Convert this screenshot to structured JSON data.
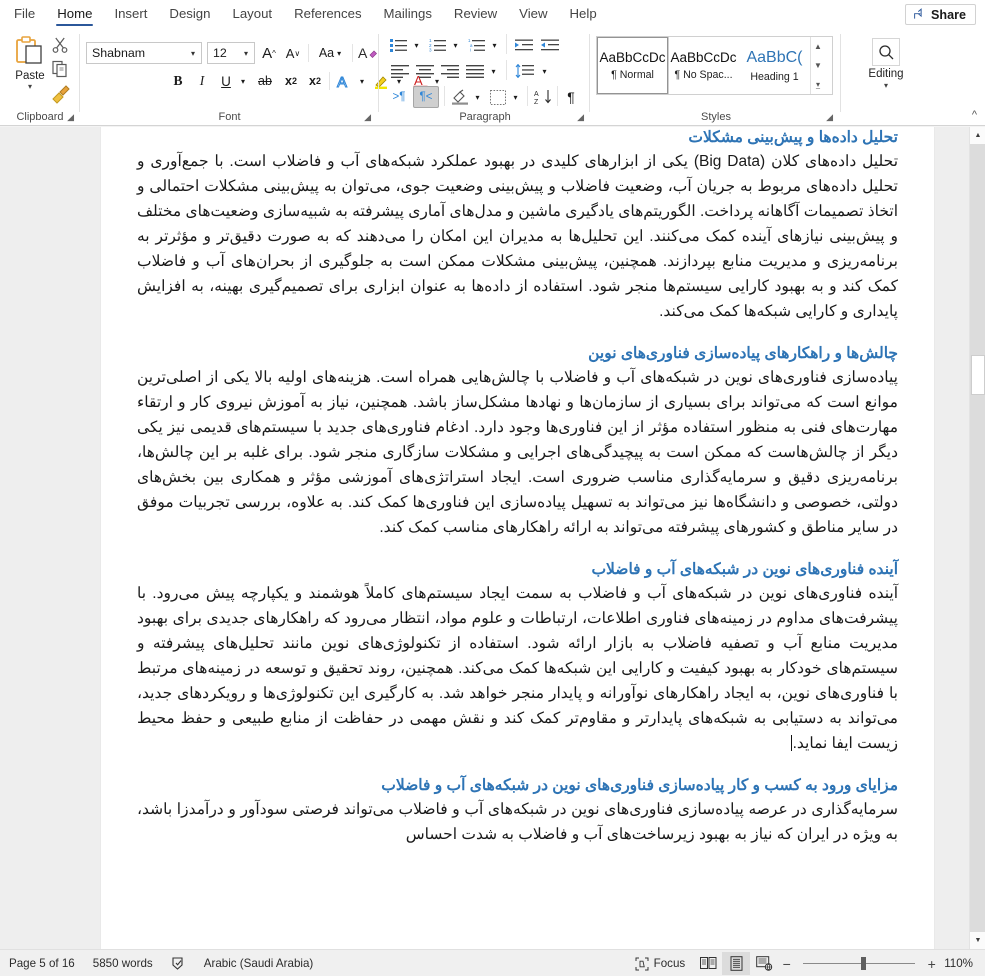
{
  "window": {
    "tabs": [
      {
        "label": "File",
        "active": false
      },
      {
        "label": "Home",
        "active": true
      },
      {
        "label": "Insert",
        "active": false
      },
      {
        "label": "Design",
        "active": false
      },
      {
        "label": "Layout",
        "active": false
      },
      {
        "label": "References",
        "active": false
      },
      {
        "label": "Mailings",
        "active": false
      },
      {
        "label": "Review",
        "active": false
      },
      {
        "label": "View",
        "active": false
      },
      {
        "label": "Help",
        "active": false
      }
    ],
    "share_label": "Share"
  },
  "ribbon": {
    "groups": {
      "clipboard": {
        "label": "Clipboard",
        "paste_label": "Paste",
        "icons": [
          "paste-icon",
          "cut-icon",
          "copy-icon",
          "format-painter-icon"
        ]
      },
      "font": {
        "label": "Font",
        "font_name": "Shabnam",
        "font_size": "12",
        "buttons": [
          "grow-font-icon",
          "shrink-font-icon",
          "change-case-icon",
          "clear-formatting-icon",
          "bold-icon",
          "italic-icon",
          "underline-icon",
          "strikethrough-icon",
          "subscript-icon",
          "superscript-icon",
          "text-effects-icon",
          "text-highlight-color-icon",
          "font-color-icon"
        ]
      },
      "paragraph": {
        "label": "Paragraph",
        "buttons": [
          "bullets-icon",
          "numbering-icon",
          "multilevel-list-icon",
          "decrease-indent-icon",
          "increase-indent-icon",
          "align-left-icon",
          "center-icon",
          "align-right-icon",
          "justify-icon",
          "line-spacing-icon",
          "ltr-text-direction-icon",
          "rtl-text-direction-icon",
          "shading-icon",
          "borders-icon",
          "sort-icon",
          "show-formatting-marks-icon"
        ],
        "rtl_selected": true
      },
      "styles": {
        "label": "Styles",
        "items": [
          {
            "sample": "AaBbCcDc",
            "name": "¶ Normal",
            "selected": true,
            "kind": "normal"
          },
          {
            "sample": "AaBbCcDc",
            "name": "¶ No Spac...",
            "selected": false,
            "kind": "normal"
          },
          {
            "sample": "AaBbC(",
            "name": "Heading 1",
            "selected": false,
            "kind": "heading"
          }
        ]
      },
      "editing": {
        "label": "Editing",
        "icon": "search-icon"
      }
    }
  },
  "document": {
    "blocks": [
      {
        "type": "heading",
        "text": "تحلیل داده‌ها و پیش‌بینی مشکلات"
      },
      {
        "type": "paragraph",
        "text": "تحلیل داده‌های کلان (Big Data) یکی از ابزارهای کلیدی در بهبود عملکرد شبکه‌های آب و فاضلاب است. با جمع‌آوری و تحلیل داده‌های مربوط به جریان آب، وضعیت فاضلاب و پیش‌بینی وضعیت جوی، می‌توان به پیش‌بینی مشکلات احتمالی و اتخاذ تصمیمات آگاهانه پرداخت. الگوریتم‌های یادگیری ماشین و مدل‌های آماری پیشرفته به شبیه‌سازی وضعیت‌های مختلف و پیش‌بینی نیازهای آینده کمک می‌کنند. این تحلیل‌ها به مدیران این امکان را می‌دهند که به صورت دقیق‌تر و مؤثرتر به برنامه‌ریزی و مدیریت منابع بپردازند. همچنین، پیش‌بینی مشکلات ممکن است به جلوگیری از بحران‌های آب و فاضلاب کمک کند و به بهبود کارایی سیستم‌ها منجر شود. استفاده از داده‌ها به عنوان ابزاری برای تصمیم‌گیری بهینه، به افزایش پایداری و کارایی شبکه‌ها کمک می‌کند."
      },
      {
        "type": "heading",
        "text": "چالش‌ها و راهکارهای پیاده‌سازی فناوری‌های نوین"
      },
      {
        "type": "paragraph",
        "text": "پیاده‌سازی فناوری‌های نوین در شبکه‌های آب و فاضلاب با چالش‌هایی همراه است. هزینه‌های اولیه بالا یکی از اصلی‌ترین موانع است که می‌تواند برای بسیاری از سازمان‌ها و نهادها مشکل‌ساز باشد. همچنین، نیاز به آموزش نیروی کار و ارتقاء مهارت‌های فنی به منظور استفاده مؤثر از این فناوری‌ها وجود دارد. ادغام فناوری‌های جدید با سیستم‌های قدیمی نیز یکی دیگر از چالش‌هاست که ممکن است به پیچیدگی‌های اجرایی و مشکلات سازگاری منجر شود. برای غلبه بر این چالش‌ها، برنامه‌ریزی دقیق و سرمایه‌گذاری مناسب ضروری است. ایجاد استراتژی‌های آموزشی مؤثر و همکاری بین بخش‌های دولتی، خصوصی و دانشگاه‌ها نیز می‌تواند به تسهیل پیاده‌سازی این فناوری‌ها کمک کند. به علاوه، بررسی تجربیات موفق در سایر مناطق و کشورهای پیشرفته می‌تواند به ارائه راهکارهای مناسب کمک کند."
      },
      {
        "type": "heading",
        "text": "آینده فناوری‌های نوین در شبکه‌های آب و فاضلاب"
      },
      {
        "type": "paragraph",
        "text": "آینده فناوری‌های نوین در شبکه‌های آب و فاضلاب به سمت ایجاد سیستم‌های کاملاً هوشمند و یکپارچه پیش می‌رود. با پیشرفت‌های مداوم در زمینه‌های فناوری اطلاعات، ارتباطات و علوم مواد، انتظار می‌رود که راهکارهای جدیدی برای بهبود مدیریت منابع آب و تصفیه فاضلاب به بازار ارائه شود. استفاده از تکنولوژی‌های نوین مانند تحلیل‌های پیشرفته و سیستم‌های خودکار به بهبود کیفیت و کارایی این شبکه‌ها کمک می‌کند. همچنین، روند تحقیق و توسعه در زمینه‌های مرتبط با فناوری‌های نوین، به ایجاد راهکارهای نوآورانه و پایدار منجر خواهد شد. به کارگیری این تکنولوژی‌ها و رویکردهای جدید، می‌تواند به دستیابی به شبکه‌های پایدارتر و مقاوم‌تر کمک کند و نقش مهمی در حفاظت از منابع طبیعی و حفظ محیط زیست ایفا نماید.",
        "has_caret": true
      },
      {
        "type": "heading",
        "text": "مزایای ورود به کسب و کار پیاده‌سازی فناوری‌های نوین در شبکه‌های آب و فاضلاب"
      },
      {
        "type": "paragraph",
        "text": "سرمایه‌گذاری در عرصه پیاده‌سازی فناوری‌های نوین در شبکه‌های آب و فاضلاب می‌تواند فرصتی سودآور و درآمدزا باشد، به ویژه در ایران که نیاز به بهبود زیرساخت‌های آب و فاضلاب به شدت احساس"
      }
    ],
    "heading_color": "#2e74b5"
  },
  "status_bar": {
    "page_info": "Page 5 of 16",
    "word_count": "5850 words",
    "proofing_icon": "proofing-errors-icon",
    "language": "Arabic (Saudi Arabia)",
    "focus_label": "Focus",
    "views": [
      {
        "name": "read-mode-view-icon",
        "active": false
      },
      {
        "name": "print-layout-view-icon",
        "active": true
      },
      {
        "name": "web-layout-view-icon",
        "active": false
      }
    ],
    "zoom_out": "−",
    "zoom_in": "+",
    "zoom_level": "110%"
  }
}
